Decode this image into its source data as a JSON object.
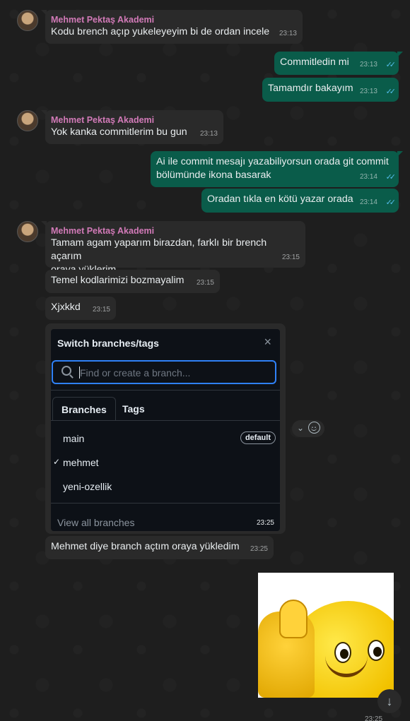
{
  "chat": {
    "messages": [
      {
        "sender": "Mehmet Pektaş Akademi",
        "text": "Kodu brench açıp yukeleyeyim bi de ordan incele",
        "time": "23:13"
      },
      {
        "text": "Commitledin mi",
        "time": "23:13"
      },
      {
        "text": "Tamamdır bakayım",
        "time": "23:13"
      },
      {
        "sender": "Mehmet Pektaş Akademi",
        "text": "Yok kanka commitlerim bu gun",
        "time": "23:13"
      },
      {
        "text_line1": "Ai ile commit mesajı yazabiliyorsun orada git commit",
        "text_line2": "bölümünde ikona basarak",
        "time": "23:14"
      },
      {
        "text": "Oradan tıkla en kötü yazar orada",
        "time": "23:14"
      },
      {
        "sender": "Mehmet Pektaş Akademi",
        "text_line1": "Tamam agam yaparım birazdan, farklı bir brench açarım",
        "text_line2": "oraya yüklerim",
        "time": "23:15"
      },
      {
        "text": "Temel kodlarimizi bozmayalim",
        "time": "23:15"
      },
      {
        "text": "Xjxkkd",
        "time": "23:15"
      },
      {
        "time": "23:25"
      },
      {
        "text": "Mehmet diye branch açtım oraya yükledim",
        "time": "23:25"
      },
      {
        "time": "23:25"
      }
    ]
  },
  "github_popup": {
    "title": "Switch branches/tags",
    "close": "×",
    "search_placeholder": "Find or create a branch...",
    "tabs": [
      "Branches",
      "Tags"
    ],
    "branches": [
      {
        "name": "main",
        "badge": "default",
        "checked": false
      },
      {
        "name": "mehmet",
        "checked": true
      },
      {
        "name": "yeni-ozellik",
        "checked": false
      }
    ],
    "footer": "View all branches"
  },
  "icons": {
    "ticks": "✓✓",
    "check": "✓",
    "chevron": "⌄",
    "scroll_down": "↓"
  },
  "colors": {
    "incoming": "#2a2a2a",
    "outgoing": "#0a5c4a",
    "sender_name": "#d27ab8",
    "read_ticks": "#53bdeb",
    "github_focus": "#2f81f7"
  }
}
